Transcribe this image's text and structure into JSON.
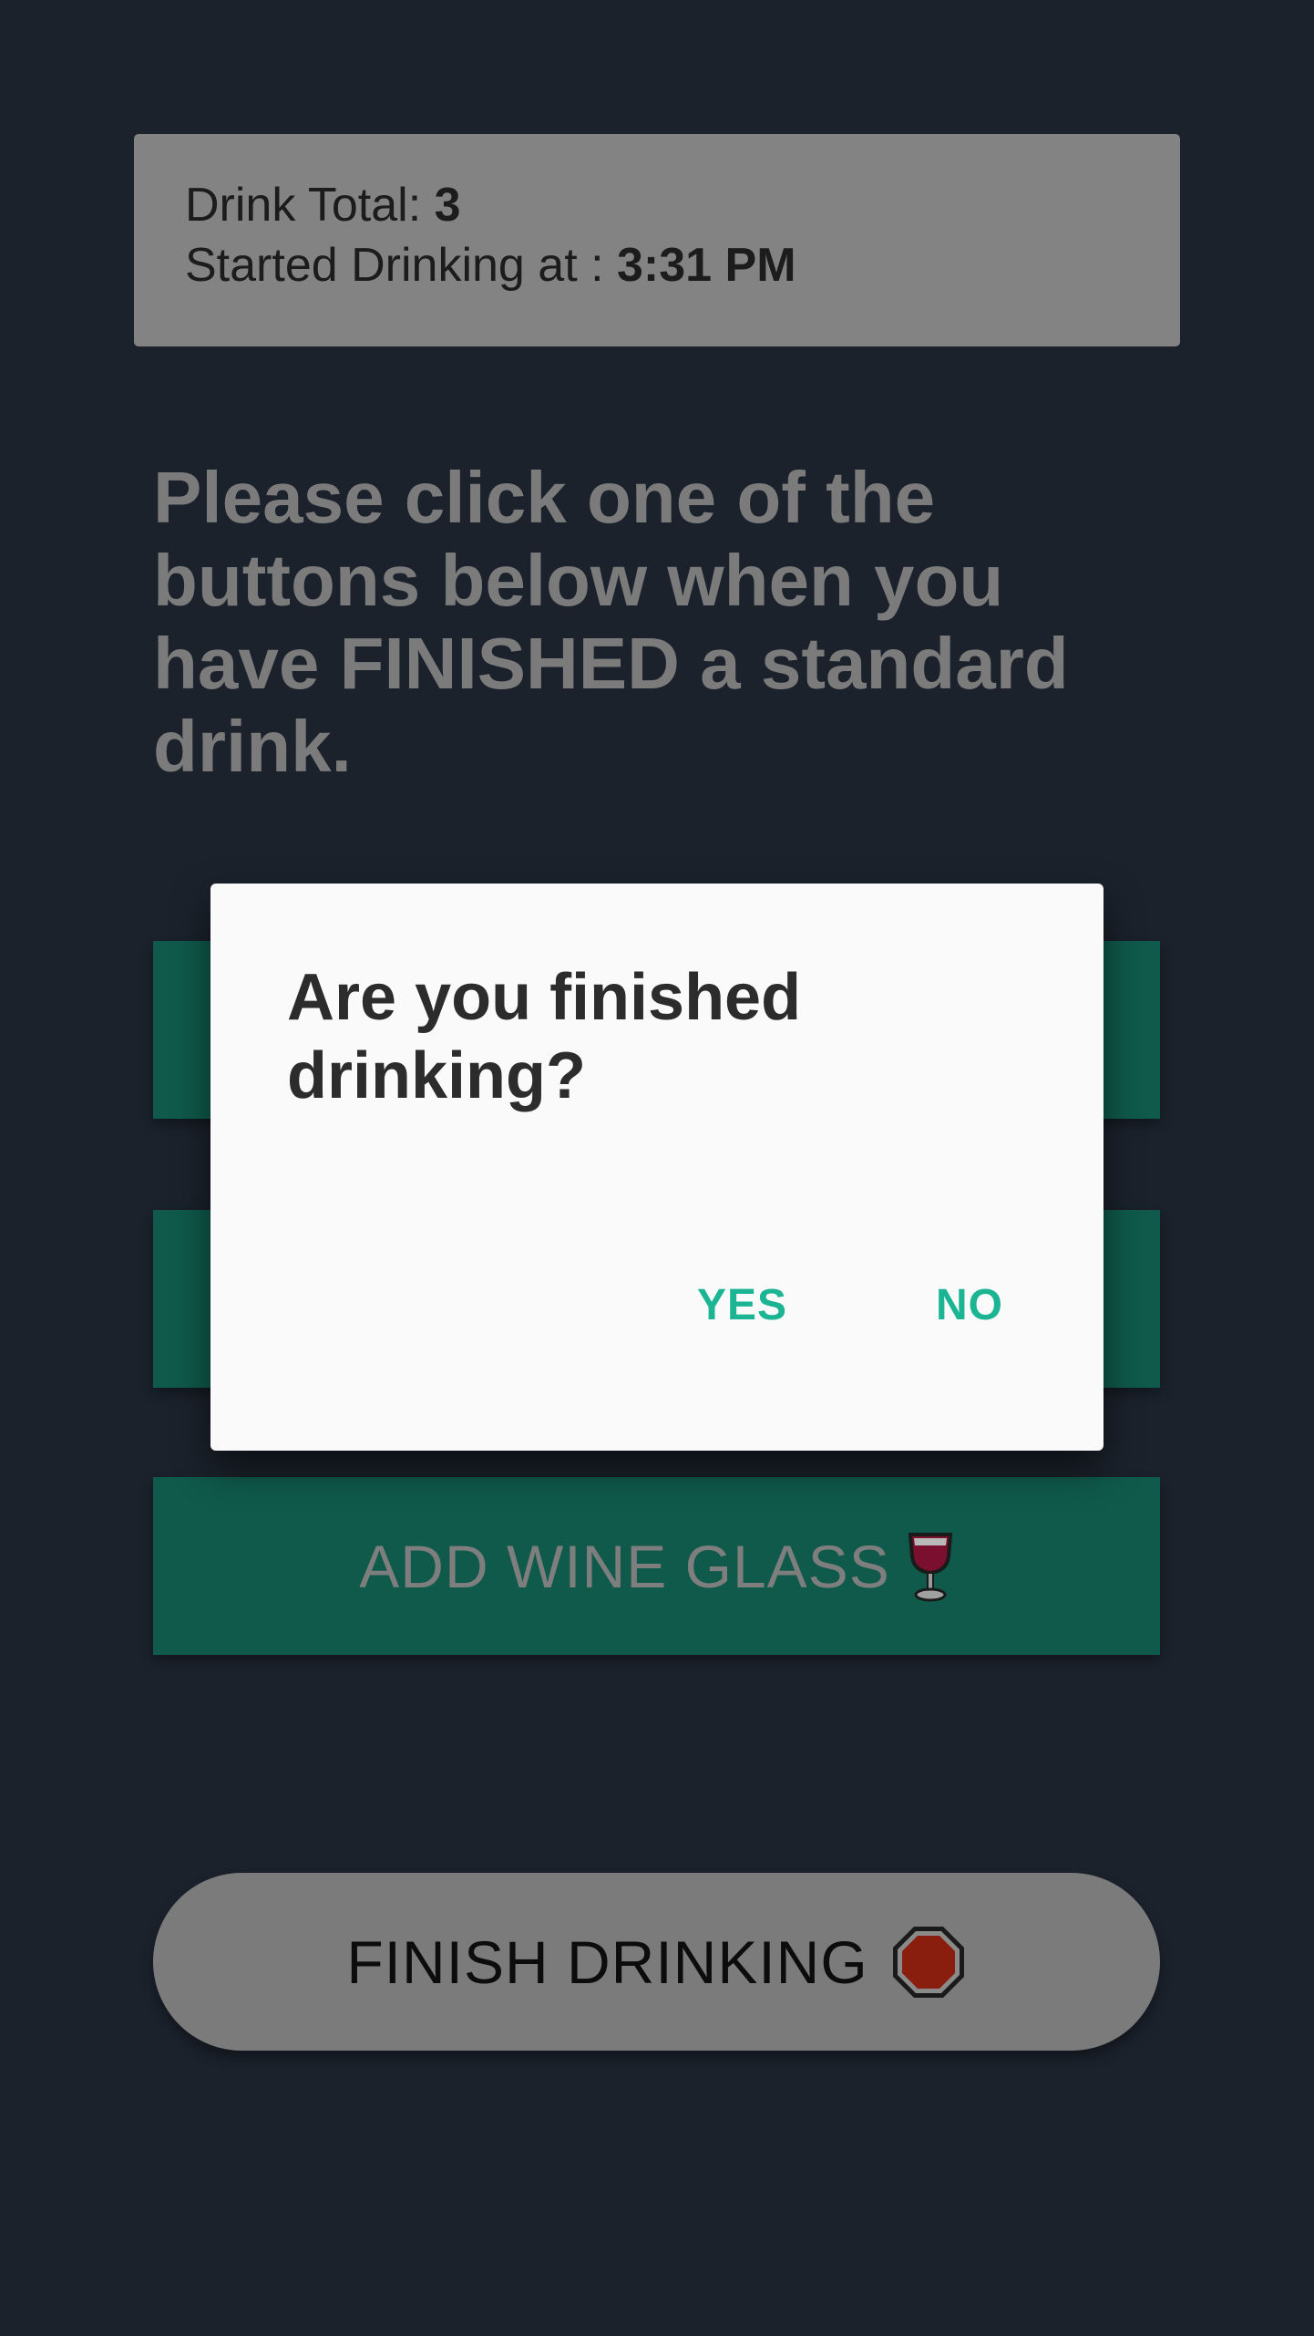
{
  "summary": {
    "drink_total_label": "Drink Total: ",
    "drink_total_value": "3",
    "started_label": "Started Drinking at : ",
    "started_value": "3:31 PM"
  },
  "instructions": "Please click one of the buttons below when you have FINISHED a standard drink.",
  "buttons": {
    "wine_label": "ADD WINE GLASS",
    "finish_label": "FINISH DRINKING"
  },
  "icons": [
    "wine-glass-icon",
    "stop-sign-icon"
  ],
  "colors": {
    "background": "#1b222c",
    "accent_button": "#0f5a4b",
    "dialog_action": "#1bb594",
    "stop_sign": "#8a1e0e",
    "wine": "#7b0f2f"
  },
  "dialog": {
    "title": "Are you finished drinking?",
    "yes_label": "YES",
    "no_label": "NO"
  }
}
